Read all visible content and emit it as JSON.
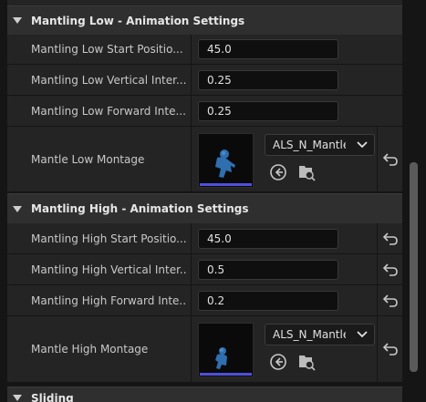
{
  "sections": {
    "low": {
      "title": "Mantling Low - Animation Settings",
      "rows": [
        {
          "label": "Mantling Low Start Positio...",
          "value": "45.0"
        },
        {
          "label": "Mantling Low Vertical Inter...",
          "value": "0.25"
        },
        {
          "label": "Mantling Low Forward Inte...",
          "value": "0.25"
        }
      ],
      "montage": {
        "label": "Mantle Low Montage",
        "asset": "ALS_N_Mantle"
      }
    },
    "high": {
      "title": "Mantling High - Animation Settings",
      "rows": [
        {
          "label": "Mantling High Start Positio...",
          "value": "45.0"
        },
        {
          "label": "Mantling High Vertical Inter...",
          "value": "0.5"
        },
        {
          "label": "Mantling High Forward Inte...",
          "value": "0.2"
        }
      ],
      "montage": {
        "label": "Mantle High Montage",
        "asset": "ALS_N_Mantle"
      }
    },
    "sliding": {
      "title": "Sliding"
    }
  },
  "icons": {
    "reset": "reset-arrow-icon",
    "use_selected": "arrow-left-circle-icon",
    "browse": "folder-search-icon",
    "dropdown": "chevron-down-icon"
  },
  "colors": {
    "thumbnail_bar": "#4f4fdc"
  }
}
